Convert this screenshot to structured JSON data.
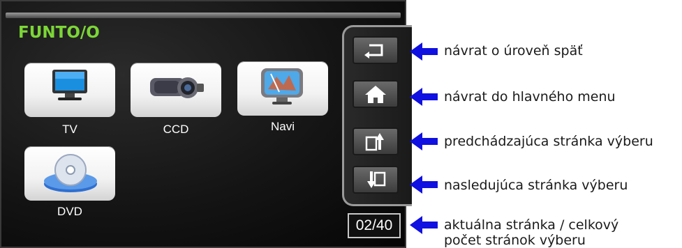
{
  "brand": {
    "logo": "FUNTO/O",
    "green": "#7cd636"
  },
  "apps": [
    {
      "label": "TV",
      "icon": "tv-monitor-icon"
    },
    {
      "label": "CCD",
      "icon": "camera-icon"
    },
    {
      "label": "Navi",
      "icon": "navigation-globe-icon"
    },
    {
      "label": "DVD",
      "icon": "disc-icon"
    }
  ],
  "side_buttons": [
    {
      "icon": "back-arrow-icon"
    },
    {
      "icon": "home-icon"
    },
    {
      "icon": "previous-page-icon"
    },
    {
      "icon": "next-page-icon"
    }
  ],
  "page_counter": "02/40",
  "annotations": [
    {
      "text": "návrat o úroveň späť"
    },
    {
      "text": "návrat do hlavného menu"
    },
    {
      "text": "predchádzajúca stránka výberu"
    },
    {
      "text": "nasledujúca stránka výberu"
    },
    {
      "line1": "aktuálna stránka / celkový",
      "line2": "počet stránok výberu"
    }
  ],
  "colors": {
    "arrow": "#1010e0",
    "screen_bg": "#141414",
    "text": "#1a1a1a"
  }
}
